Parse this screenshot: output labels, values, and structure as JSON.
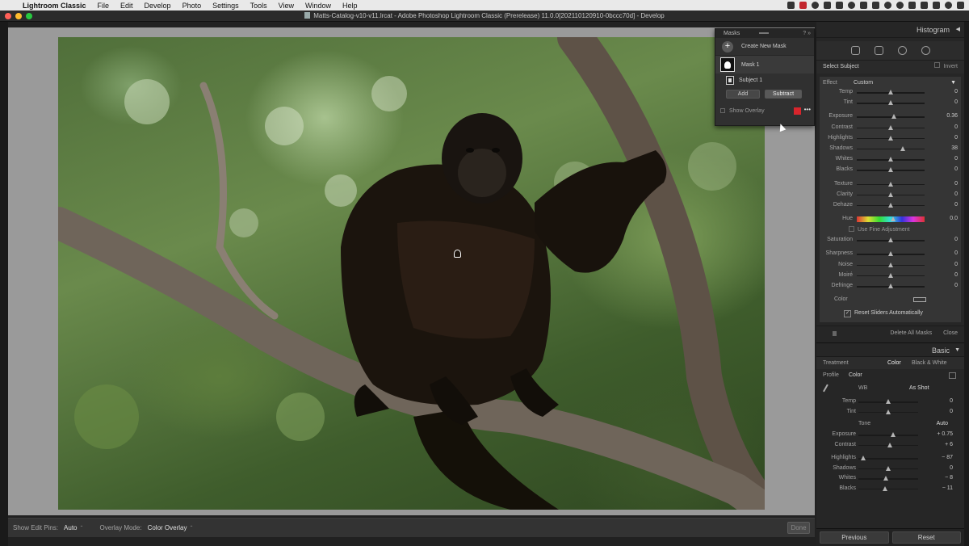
{
  "menubar": {
    "app_name": "Lightroom Classic",
    "items": [
      "File",
      "Edit",
      "Develop",
      "Photo",
      "Settings",
      "Tools",
      "View",
      "Window",
      "Help"
    ]
  },
  "window": {
    "title": "Matts-Catalog-v10-v11.lrcat - Adobe Photoshop Lightroom Classic (Prerelease) 11.0.0[202110120910-0bccc70d] - Develop"
  },
  "masks_panel": {
    "title": "Masks",
    "create_label": "Create New Mask",
    "mask_name": "Mask 1",
    "component_name": "Subject 1",
    "add_label": "Add",
    "subtract_label": "Subtract",
    "show_overlay_label": "Show Overlay",
    "overlay_color": "#d8252c"
  },
  "toolbar": {
    "show_edit_pins_label": "Show Edit Pins:",
    "show_edit_pins_value": "Auto",
    "overlay_mode_label": "Overlay Mode:",
    "overlay_mode_value": "Color Overlay",
    "done_label": "Done"
  },
  "right_panel": {
    "histogram_label": "Histogram",
    "select_subject_label": "Select Subject",
    "invert_label": "Invert",
    "effect_label": "Effect",
    "effect_value": "Custom",
    "sliders": [
      {
        "label": "Temp",
        "value": "0",
        "pos": 0.5
      },
      {
        "label": "Tint",
        "value": "0",
        "pos": 0.5
      },
      {
        "label": "Exposure",
        "value": "0.36",
        "pos": 0.55
      },
      {
        "label": "Contrast",
        "value": "0",
        "pos": 0.5
      },
      {
        "label": "Highlights",
        "value": "0",
        "pos": 0.5
      },
      {
        "label": "Shadows",
        "value": "38",
        "pos": 0.68
      },
      {
        "label": "Whites",
        "value": "0",
        "pos": 0.5
      },
      {
        "label": "Blacks",
        "value": "0",
        "pos": 0.5
      },
      {
        "label": "Texture",
        "value": "0",
        "pos": 0.5
      },
      {
        "label": "Clarity",
        "value": "0",
        "pos": 0.5
      },
      {
        "label": "Dehaze",
        "value": "0",
        "pos": 0.5
      }
    ],
    "hue": {
      "label": "Hue",
      "value": "0.0",
      "pos": 0.5
    },
    "fine_adjust_label": "Use Fine Adjustment",
    "sliders2": [
      {
        "label": "Saturation",
        "value": "0",
        "pos": 0.5
      },
      {
        "label": "Sharpness",
        "value": "0",
        "pos": 0.5
      },
      {
        "label": "Noise",
        "value": "0",
        "pos": 0.5
      },
      {
        "label": "Moiré",
        "value": "0",
        "pos": 0.5
      },
      {
        "label": "Defringe",
        "value": "0",
        "pos": 0.5
      }
    ],
    "color_label": "Color",
    "reset_label": "Reset Sliders Automatically",
    "delete_all_label": "Delete All Masks",
    "close_label": "Close",
    "basic_label": "Basic",
    "treatment_label": "Treatment",
    "treatment_color": "Color",
    "treatment_bw": "Black & White",
    "profile_label": "Profile",
    "profile_value": "Color",
    "wb_label": "WB",
    "wb_value": "As Shot",
    "basic_wb": [
      {
        "label": "Temp",
        "value": "0",
        "pos": 0.5
      },
      {
        "label": "Tint",
        "value": "0",
        "pos": 0.5
      }
    ],
    "tone_label": "Tone",
    "auto_label": "Auto",
    "basic_tone": [
      {
        "label": "Exposure",
        "value": "+ 0.75",
        "pos": 0.58
      },
      {
        "label": "Contrast",
        "value": "+ 6",
        "pos": 0.53
      },
      {
        "label": "Highlights",
        "value": "− 87",
        "pos": 0.08
      },
      {
        "label": "Shadows",
        "value": "0",
        "pos": 0.5
      },
      {
        "label": "Whites",
        "value": "− 8",
        "pos": 0.46
      },
      {
        "label": "Blacks",
        "value": "− 11",
        "pos": 0.45
      }
    ],
    "previous_label": "Previous",
    "reset_button_label": "Reset"
  }
}
